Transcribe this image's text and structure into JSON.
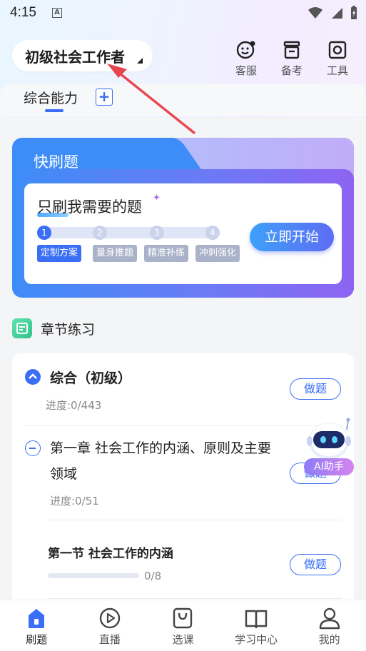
{
  "status_bar": {
    "time": "4:15",
    "notif_glyph": "A"
  },
  "header": {
    "exam_title": "初级社会工作者",
    "actions": [
      {
        "label": "客服",
        "icon": "customer-service-icon"
      },
      {
        "label": "备考",
        "icon": "archive-box-icon"
      },
      {
        "label": "工具",
        "icon": "toolbox-icon"
      }
    ]
  },
  "tabs": {
    "active": "综合能力",
    "add": "+"
  },
  "quick_card": {
    "title": "快刷题",
    "subtitle": "只刷我需要的题",
    "steps": [
      {
        "num": "1",
        "label": "定制方案",
        "active": true
      },
      {
        "num": "2",
        "label": "量身推题",
        "active": false
      },
      {
        "num": "3",
        "label": "精准补练",
        "active": false
      },
      {
        "num": "4",
        "label": "冲刺强化",
        "active": false
      }
    ],
    "start_button": "立即开始"
  },
  "chapter_section": {
    "title": "章节练习",
    "items": [
      {
        "title": "综合（初级）",
        "progress": "进度:0/443",
        "button": "做题"
      },
      {
        "title": "第一章 社会工作的内涵、原则及主要领域",
        "progress": "进度:0/51",
        "button": "做题"
      },
      {
        "title": "第一节 社会工作的内涵",
        "progress": "0/8",
        "button": "做题"
      }
    ]
  },
  "ai_helper": {
    "label": "AI助手"
  },
  "bottom_nav": [
    {
      "label": "刷题",
      "icon": "home-icon",
      "active": true
    },
    {
      "label": "直播",
      "icon": "play-circle-icon",
      "active": false
    },
    {
      "label": "选课",
      "icon": "shopping-bag-icon",
      "active": false
    },
    {
      "label": "学习中心",
      "icon": "book-icon",
      "active": false
    },
    {
      "label": "我的",
      "icon": "user-icon",
      "active": false
    }
  ],
  "colors": {
    "accent": "#3a6ff5",
    "annotation": "#e8464f"
  }
}
